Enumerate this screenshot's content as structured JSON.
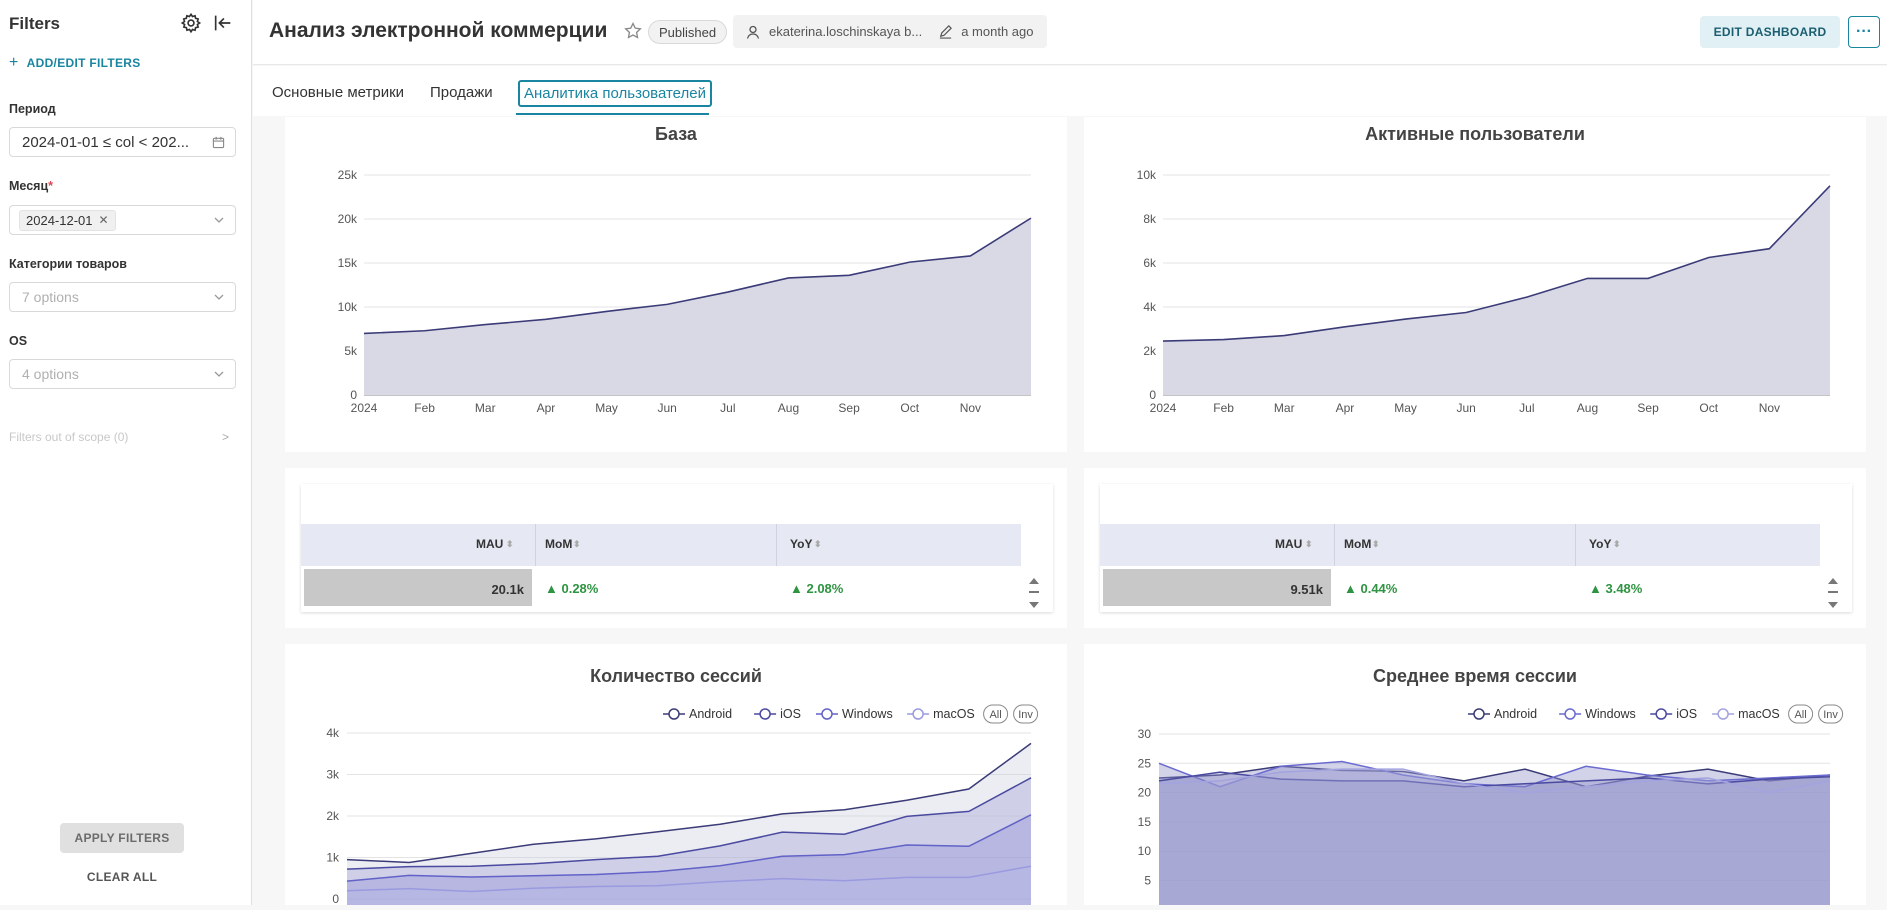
{
  "sidebar": {
    "title": "Filters",
    "add_filters": "ADD/EDIT FILTERS",
    "filters": [
      {
        "label": "Период",
        "value": "2024-01-01 ≤ col < 202..."
      },
      {
        "label": "Месяц",
        "required": "*",
        "tag": "2024-12-01"
      },
      {
        "label": "Категории товаров",
        "placeholder": "7 options"
      },
      {
        "label": "OS",
        "placeholder": "4 options"
      }
    ],
    "out_of_scope": "Filters out of scope (0)",
    "apply": "APPLY FILTERS",
    "clear": "CLEAR ALL"
  },
  "header": {
    "title": "Анализ электронной коммерции",
    "status": "Published",
    "owner": "ekaterina.loschinskaya b...",
    "modified": "a month ago",
    "edit": "EDIT DASHBOARD",
    "more": "···"
  },
  "tabs": [
    "Основные метрики",
    "Продажи",
    "Аналитика пользователей"
  ],
  "colors": {
    "accent": "#1a85a0",
    "line_dark": "#3b3b78",
    "fill": "#d9d9e6",
    "green": "#2e9441"
  },
  "chart_data": [
    {
      "type": "area",
      "title": "База",
      "x": [
        "2024",
        "Feb",
        "Mar",
        "Apr",
        "May",
        "Jun",
        "Jul",
        "Aug",
        "Sep",
        "Oct",
        "Nov",
        ""
      ],
      "values": [
        7000,
        7300,
        8000,
        8600,
        9500,
        10300,
        11700,
        13300,
        13600,
        15100,
        15800,
        20100
      ],
      "yticks": [
        "0",
        "5k",
        "10k",
        "15k",
        "20k",
        "25k"
      ],
      "ylim": [
        0,
        25000
      ]
    },
    {
      "type": "area",
      "title": "Активные пользователи",
      "x": [
        "2024",
        "Feb",
        "Mar",
        "Apr",
        "May",
        "Jun",
        "Jul",
        "Aug",
        "Sep",
        "Oct",
        "Nov",
        ""
      ],
      "values": [
        2450,
        2520,
        2700,
        3100,
        3450,
        3750,
        4450,
        5300,
        5300,
        6250,
        6650,
        9510
      ],
      "yticks": [
        "0",
        "2k",
        "4k",
        "6k",
        "8k",
        "10k"
      ],
      "ylim": [
        0,
        10000
      ]
    },
    {
      "type": "area",
      "title": "Количество сессий",
      "legend": [
        "Android",
        "iOS",
        "Windows",
        "macOS"
      ],
      "legend_btns": [
        "All",
        "Inv"
      ],
      "yticks": [
        "0",
        "1k",
        "2k",
        "3k",
        "4k"
      ],
      "ylim": [
        0,
        4000
      ],
      "series": [
        {
          "name": "Android",
          "values": [
            950,
            880,
            1100,
            1320,
            1450,
            1620,
            1800,
            2050,
            2150,
            2380,
            2650,
            3750
          ]
        },
        {
          "name": "iOS",
          "values": [
            720,
            780,
            790,
            850,
            950,
            1030,
            1280,
            1610,
            1560,
            1990,
            2110,
            2920
          ]
        },
        {
          "name": "Windows",
          "values": [
            430,
            570,
            530,
            560,
            590,
            660,
            800,
            1030,
            1070,
            1300,
            1270,
            2030
          ]
        },
        {
          "name": "macOS",
          "values": [
            200,
            250,
            180,
            260,
            300,
            320,
            420,
            490,
            440,
            520,
            520,
            790
          ]
        }
      ]
    },
    {
      "type": "area",
      "title": "Среднее время сессии",
      "legend": [
        "Android",
        "Windows",
        "iOS",
        "macOS"
      ],
      "legend_btns": [
        "All",
        "Inv"
      ],
      "yticks": [
        "5",
        "10",
        "15",
        "20",
        "25",
        "30"
      ],
      "ylim": [
        0,
        30
      ],
      "series": [
        {
          "name": "Android",
          "values": [
            22.5,
            23,
            24.5,
            23.8,
            23.6,
            22,
            24,
            21,
            22.8,
            24,
            22,
            23
          ]
        },
        {
          "name": "Windows",
          "values": [
            25,
            21,
            24.5,
            25.3,
            23,
            21.5,
            21,
            24.5,
            23,
            22,
            22.5,
            23
          ]
        },
        {
          "name": "iOS",
          "values": [
            22,
            23.5,
            22.3,
            22,
            22,
            21,
            21.5,
            22,
            22.5,
            21.5,
            22.3,
            22.7
          ]
        },
        {
          "name": "macOS",
          "values": [
            21.5,
            22,
            23.5,
            24,
            24,
            21.5,
            20,
            21,
            22,
            22.5,
            20,
            22
          ]
        }
      ]
    }
  ],
  "tables": [
    {
      "headers": [
        "MAU",
        "MoM",
        "YoY"
      ],
      "mau": "20.1k",
      "mom": "▲ 0.28%",
      "yoy": "▲ 2.08%",
      "mau_fill": 0.8
    },
    {
      "headers": [
        "MAU",
        "MoM",
        "YoY"
      ],
      "mau": "9.51k",
      "mom": "▲ 0.44%",
      "yoy": "▲ 3.48%",
      "mau_fill": 0.8
    }
  ]
}
